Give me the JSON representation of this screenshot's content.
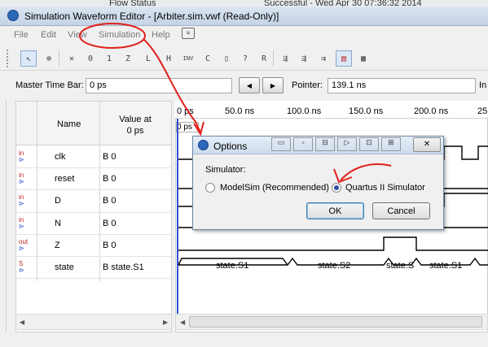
{
  "window": {
    "title": "Simulation Waveform Editor - [Arbiter.sim.vwf (Read-Only)]",
    "bg_flow_status": "Flow Status",
    "bg_status": "Successful - Wed Apr 30 07:36:32 2014"
  },
  "menu": [
    "File",
    "Edit",
    "View",
    "Simulation",
    "Help"
  ],
  "toolbar": {
    "icons": [
      "pointer-tool",
      "zoom-tool",
      "force-unknown",
      "force-low",
      "force-high",
      "force-high-impedance",
      "force-weak-low",
      "force-weak-high",
      "invert",
      "count-value",
      "force-clock",
      "random-values",
      "arbitrary-value",
      "run-functional-sim",
      "run-timing-sim",
      "generate-netlist",
      "snap-to-grid",
      "overwrite-clock"
    ]
  },
  "timebar": {
    "master_label": "Master Time Bar:",
    "master_value": "0 ps",
    "pointer_label": "Pointer:",
    "pointer_value": "139.1 ns",
    "interval_label": "In"
  },
  "grid": {
    "col_name": "Name",
    "col_value": "Value at\n0 ps",
    "time_labels": [
      "0 ps",
      "50.0 ns",
      "100.0 ns",
      "150.0 ns",
      "200.0 ns",
      "25"
    ],
    "cursor_label": "0 ps",
    "signals": [
      {
        "dir": "in",
        "name": "clk",
        "value": "B 0"
      },
      {
        "dir": "in",
        "name": "reset",
        "value": "B 0"
      },
      {
        "dir": "in",
        "name": "D",
        "value": "B 0"
      },
      {
        "dir": "in",
        "name": "N",
        "value": "B 0"
      },
      {
        "dir": "out",
        "name": "Z",
        "value": "B 0"
      },
      {
        "dir": "S",
        "name": "state",
        "value": "B state.S1"
      }
    ],
    "state_bus": [
      "state.S1",
      "state.S2",
      "state.S",
      "state.S1"
    ]
  },
  "dialog": {
    "title": "Options",
    "group_label": "Simulator:",
    "option_modelsim": "ModelSim (Recommended)",
    "option_quartus": "Quartus II Simulator",
    "selected": "Quartus II Simulator",
    "ok": "OK",
    "cancel": "Cancel"
  },
  "colors": {
    "annotation": "#e0201c",
    "accent": "#3050d0"
  }
}
